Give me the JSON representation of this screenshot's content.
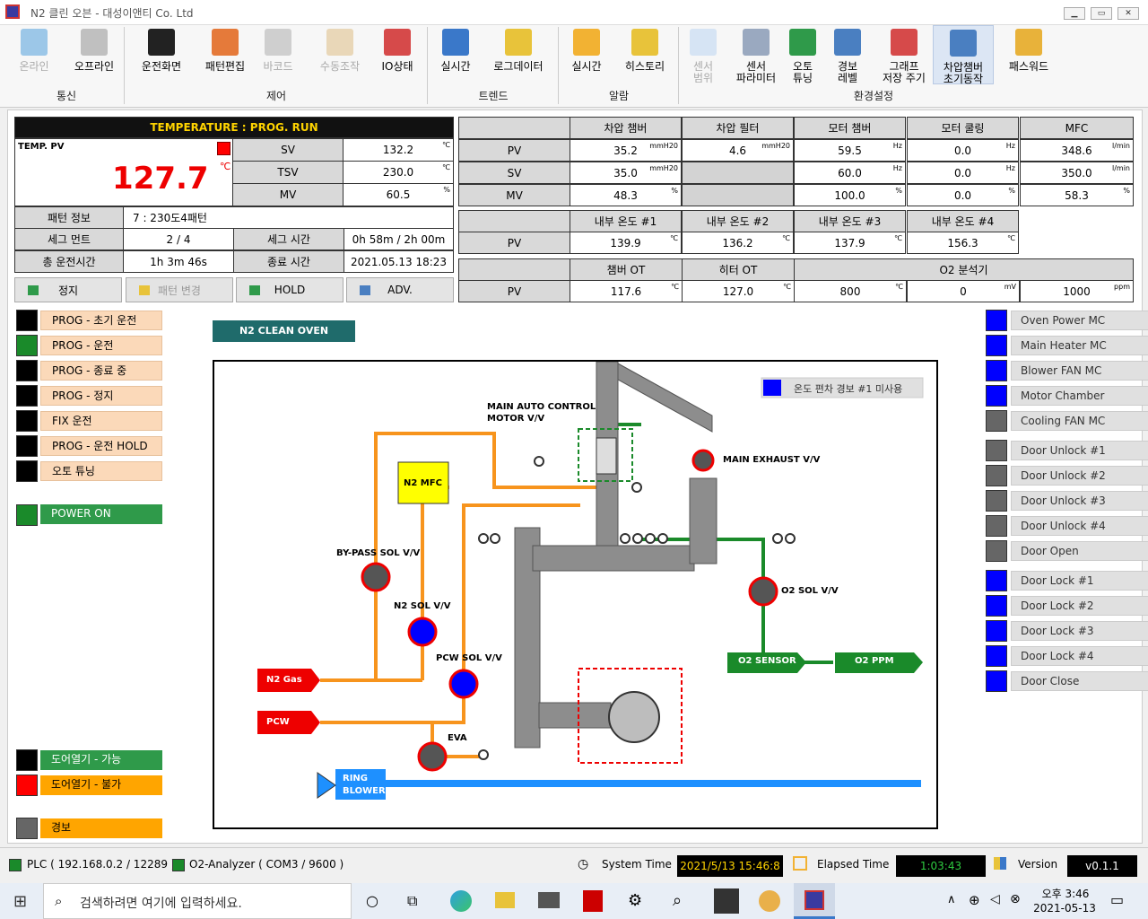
{
  "window": {
    "title": "N2 클린 오븐 - 대성이앤티 Co. Ltd",
    "min": "▁",
    "max": "▭",
    "close": "✕"
  },
  "ribbon": {
    "buttons": [
      {
        "label": "온라인",
        "color": "#9cc7e8"
      },
      {
        "label": "오프라인",
        "color": "#c0c0c0"
      },
      {
        "label": "운전화면",
        "color": "#222"
      },
      {
        "label": "패턴편집",
        "color": "#e57a3a"
      },
      {
        "label": "바코드",
        "color": "#cfcfcf"
      },
      {
        "label": "수동조작",
        "color": "#e9d7b8"
      },
      {
        "label": "IO상태",
        "color": "#d64a4a"
      },
      {
        "label": "실시간",
        "color": "#3a78c9"
      },
      {
        "label": "로그데이터",
        "color": "#e8c33a"
      },
      {
        "label": "실시간",
        "color": "#f2b233"
      },
      {
        "label": "히스토리",
        "color": "#e8c33a"
      },
      {
        "label": "센서\n범위",
        "color": "#d6e4f4"
      },
      {
        "label": "센서\n파라미터",
        "color": "#9aa9c0"
      },
      {
        "label": "오토\n튜닝",
        "color": "#2f9a4a"
      },
      {
        "label": "경보\n레벨",
        "color": "#4a7fc1"
      },
      {
        "label": "그래프\n저장 주기",
        "color": "#d64a4a"
      },
      {
        "label": "차압챔버\n초기동작",
        "color": "#4a7fc1"
      },
      {
        "label": "패스워드",
        "color": "#e8b23a"
      }
    ],
    "groups": [
      "통신",
      "제어",
      "트렌드",
      "알람",
      "환경설정"
    ]
  },
  "temp": {
    "header": "TEMPERATURE : PROG. RUN",
    "pv_label": "TEMP. PV",
    "pv": "127.7",
    "pv_unit": "℃",
    "rows": [
      {
        "label": "SV",
        "value": "132.2",
        "unit": "℃"
      },
      {
        "label": "TSV",
        "value": "230.0",
        "unit": "℃"
      },
      {
        "label": "MV",
        "value": "60.5",
        "unit": "%"
      }
    ],
    "pattern_label": "패턴 정보",
    "pattern": "7 : 230도4패턴",
    "segment_label": "세그 먼트",
    "segment": "2 / 4",
    "segtime_label": "세그 시간",
    "segtime": "0h 58m / 2h 00m",
    "total_label": "총 운전시간",
    "total": "1h 3m 46s",
    "end_label": "종료 시간",
    "end": "2021.05.13 18:23"
  },
  "ctrl_buttons": [
    {
      "label": "정지"
    },
    {
      "label": "패턴 변경"
    },
    {
      "label": "HOLD"
    },
    {
      "label": "ADV."
    }
  ],
  "grid1": {
    "cols": [
      "차압 챔버",
      "차압 필터",
      "모터 챔버",
      "모터 쿨링",
      "MFC"
    ],
    "rows": [
      {
        "label": "PV",
        "vals": [
          "35.2",
          "4.6",
          "59.5",
          "0.0",
          "348.6"
        ],
        "units": [
          "mmH20",
          "mmH20",
          "Hz",
          "Hz",
          "l/min"
        ]
      },
      {
        "label": "SV",
        "vals": [
          "35.0",
          "",
          "60.0",
          "0.0",
          "350.0"
        ],
        "units": [
          "mmH20",
          "",
          "Hz",
          "Hz",
          "l/min"
        ]
      },
      {
        "label": "MV",
        "vals": [
          "48.3",
          "",
          "100.0",
          "0.0",
          "58.3"
        ],
        "units": [
          "%",
          "",
          "%",
          "%",
          "%"
        ]
      }
    ]
  },
  "grid2": {
    "cols": [
      "내부 온도 #1",
      "내부 온도 #2",
      "내부 온도 #3",
      "내부 온도 #4"
    ],
    "label": "PV",
    "vals": [
      "139.9",
      "136.2",
      "137.9",
      "156.3"
    ],
    "unit": "℃"
  },
  "grid3": {
    "cols": [
      "챔버 OT",
      "히터 OT",
      "O2 분석기"
    ],
    "label": "PV",
    "vals": [
      "117.6",
      "127.0",
      "800",
      "0",
      "1000"
    ],
    "units": [
      "℃",
      "℃",
      "℃",
      "mV",
      "ppm"
    ]
  },
  "left_status": [
    {
      "label": "PROG - 초기 운전",
      "lamp": "#000"
    },
    {
      "label": "PROG - 운전",
      "lamp": "#1a8a2a"
    },
    {
      "label": "PROG - 종료 중",
      "lamp": "#000"
    },
    {
      "label": "PROG - 정지",
      "lamp": "#000"
    },
    {
      "label": "FIX 운전",
      "lamp": "#000"
    },
    {
      "label": "PROG - 운전 HOLD",
      "lamp": "#000"
    },
    {
      "label": "오토 튜닝",
      "lamp": "#000"
    }
  ],
  "power": {
    "label": "POWER ON",
    "lamp": "#1a8a2a"
  },
  "door_status": [
    {
      "label": "도어열기 - 가능",
      "lamp": "#000",
      "style": "green"
    },
    {
      "label": "도어열기 - 불가",
      "lamp": "#f00",
      "style": "orange"
    }
  ],
  "alarm": {
    "label": "경보",
    "lamp": "#666"
  },
  "right_status": [
    {
      "label": "Oven Power MC",
      "lamp": "#0000ff"
    },
    {
      "label": "Main Heater MC",
      "lamp": "#0000ff"
    },
    {
      "label": "Blower FAN MC",
      "lamp": "#0000ff"
    },
    {
      "label": "Motor Chamber",
      "lamp": "#0000ff"
    },
    {
      "label": "Cooling FAN MC",
      "lamp": "#666"
    },
    {
      "label": "Door Unlock #1",
      "lamp": "#666"
    },
    {
      "label": "Door Unlock #2",
      "lamp": "#666"
    },
    {
      "label": "Door Unlock #3",
      "lamp": "#666"
    },
    {
      "label": "Door Unlock #4",
      "lamp": "#666"
    },
    {
      "label": "Door Open",
      "lamp": "#666"
    },
    {
      "label": "Door Lock #1",
      "lamp": "#0000ff"
    },
    {
      "label": "Door Lock #2",
      "lamp": "#0000ff"
    },
    {
      "label": "Door Lock #3",
      "lamp": "#0000ff"
    },
    {
      "label": "Door Lock #4",
      "lamp": "#0000ff"
    },
    {
      "label": "Door Close",
      "lamp": "#0000ff"
    }
  ],
  "diagram": {
    "title": "N2 CLEAN OVEN",
    "alarm_label": "온도 편차 경보 #1 미사용",
    "labels": {
      "main_auto": "MAIN AUTO CONTROL",
      "motor_vv": "MOTOR V/V",
      "main_exhaust": "MAIN EXHAUST V/V",
      "n2mfc": "N2 MFC",
      "bypass": "BY-PASS SOL V/V",
      "n2sol": "N2 SOL V/V",
      "pcwsol": "PCW SOL V/V",
      "o2sol": "O2 SOL V/V",
      "o2sensor": "O2 SENSOR",
      "o2ppm": "O2 PPM",
      "n2gas": "N2 Gas",
      "pcw": "PCW",
      "eva": "EVA",
      "ring1": "RING",
      "ring2": "BLOWER"
    }
  },
  "statusbar": {
    "plc": "PLC ( 192.168.0.2 / 12289 )",
    "o2": "O2-Analyzer ( COM3 / 9600 )",
    "sys_label": "System Time",
    "sys_time": "2021/5/13 15:46:8",
    "el_label": "Elapsed Time",
    "el_time": "1:03:43",
    "ver_label": "Version",
    "ver": "v0.1.1"
  },
  "taskbar": {
    "search": "검색하려면 여기에 입력하세요.",
    "time": "오후 3:46",
    "date": "2021-05-13"
  }
}
